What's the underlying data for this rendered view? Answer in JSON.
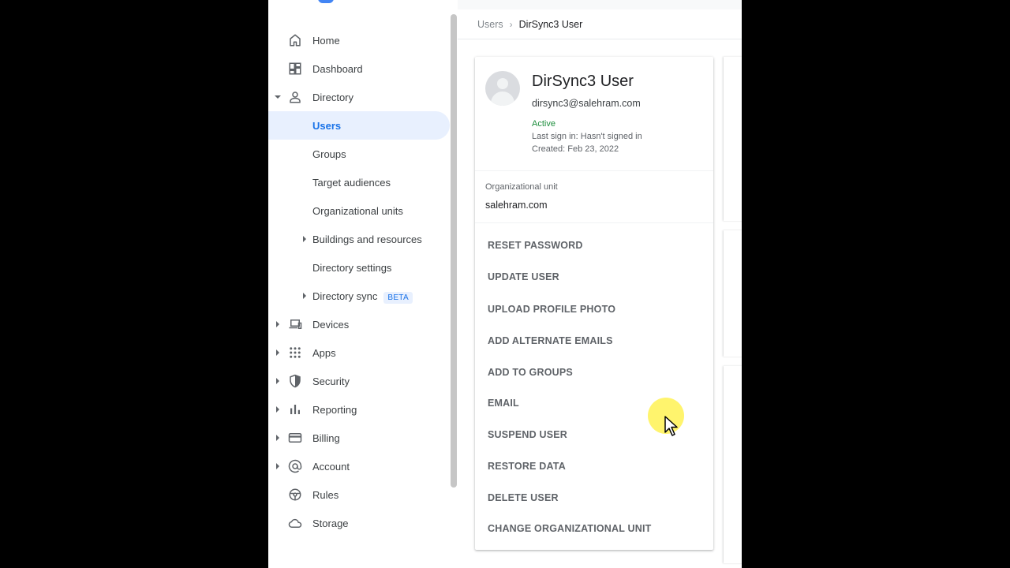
{
  "sidebar": {
    "items": [
      {
        "label": "Home",
        "icon": "home-icon",
        "expand": "none"
      },
      {
        "label": "Dashboard",
        "icon": "dashboard-icon",
        "expand": "none"
      },
      {
        "label": "Directory",
        "icon": "person-icon",
        "expand": "expanded"
      },
      {
        "label": "Users",
        "active": true
      },
      {
        "label": "Groups"
      },
      {
        "label": "Target audiences"
      },
      {
        "label": "Organizational units"
      },
      {
        "label": "Buildings and resources",
        "expand": "collapsed"
      },
      {
        "label": "Directory settings"
      },
      {
        "label": "Directory sync",
        "badge": "BETA",
        "expand": "collapsed"
      },
      {
        "label": "Devices",
        "icon": "devices-icon",
        "expand": "collapsed"
      },
      {
        "label": "Apps",
        "icon": "apps-grid-icon",
        "expand": "collapsed"
      },
      {
        "label": "Security",
        "icon": "shield-icon",
        "expand": "collapsed"
      },
      {
        "label": "Reporting",
        "icon": "bar-chart-icon",
        "expand": "collapsed"
      },
      {
        "label": "Billing",
        "icon": "credit-card-icon",
        "expand": "collapsed"
      },
      {
        "label": "Account",
        "icon": "at-sign-icon",
        "expand": "collapsed"
      },
      {
        "label": "Rules",
        "icon": "steering-wheel-icon",
        "expand": "none"
      },
      {
        "label": "Storage",
        "icon": "cloud-icon",
        "expand": "none"
      }
    ]
  },
  "breadcrumb": {
    "parent": "Users",
    "separator": "›",
    "current": "DirSync3 User"
  },
  "user": {
    "name": "DirSync3 User",
    "email": "dirsync3@salehram.com",
    "status": "Active",
    "last_sign_in": "Last sign in: Hasn't signed in",
    "created": "Created: Feb 23, 2022"
  },
  "org_unit": {
    "label": "Organizational unit",
    "value": "salehram.com"
  },
  "actions": [
    "RESET PASSWORD",
    "UPDATE USER",
    "UPLOAD PROFILE PHOTO",
    "ADD ALTERNATE EMAILS",
    "ADD TO GROUPS",
    "EMAIL",
    "SUSPEND USER",
    "RESTORE DATA",
    "DELETE USER",
    "CHANGE ORGANIZATIONAL UNIT"
  ],
  "colors": {
    "accent": "#1a73e8",
    "active_bg": "#e8f0fe",
    "status_active": "#1e8e3e",
    "cursor_highlight": "#fff03c"
  }
}
